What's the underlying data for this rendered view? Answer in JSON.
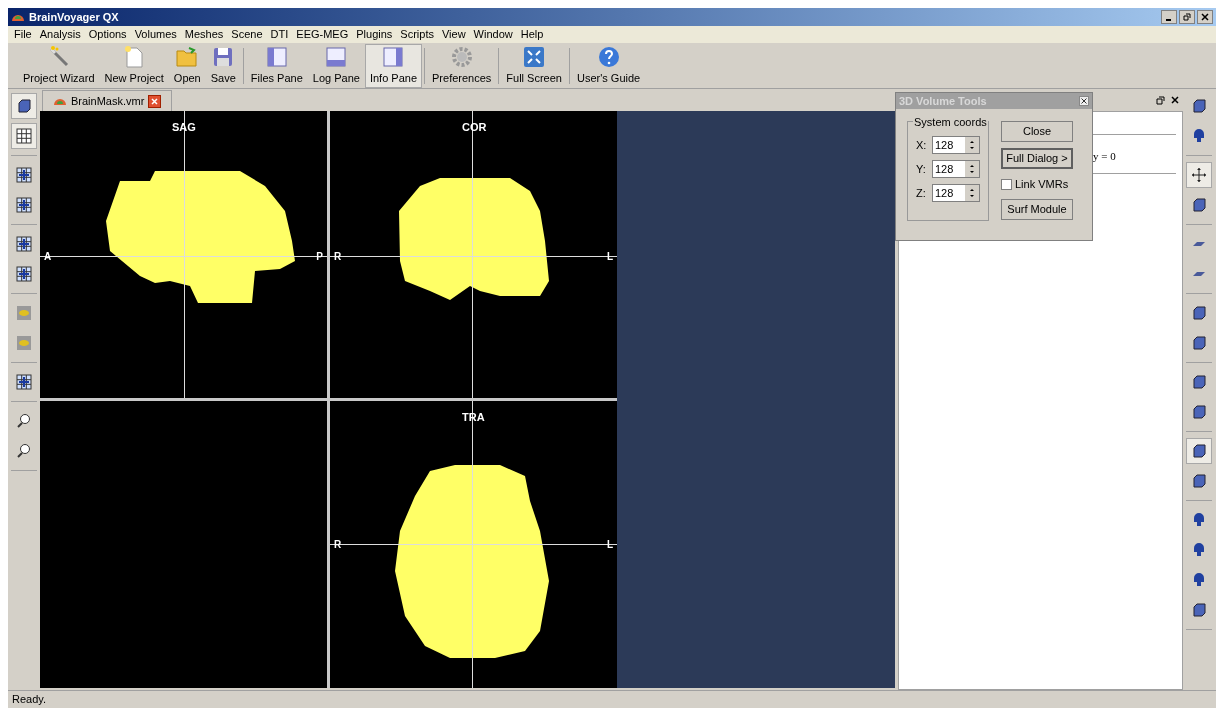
{
  "window": {
    "title": "BrainVoyager QX"
  },
  "menu": [
    "File",
    "Analysis",
    "Options",
    "Volumes",
    "Meshes",
    "Scene",
    "DTI",
    "EEG-MEG",
    "Plugins",
    "Scripts",
    "View",
    "Window",
    "Help"
  ],
  "toolbar": [
    {
      "label": "Project Wizard",
      "selected": false
    },
    {
      "label": "New Project",
      "selected": false
    },
    {
      "label": "Open",
      "selected": false
    },
    {
      "label": "Save",
      "selected": false
    },
    {
      "label": "Files Pane",
      "selected": false
    },
    {
      "label": "Log Pane",
      "selected": false
    },
    {
      "label": "Info Pane",
      "selected": true
    },
    {
      "label": "Preferences",
      "selected": false
    },
    {
      "label": "Full Screen",
      "selected": false
    },
    {
      "label": "User's Guide",
      "selected": false
    }
  ],
  "document_tab": {
    "label": "BrainMask.vmr"
  },
  "left_tools": [
    [
      {
        "selected": true
      },
      {
        "selected": true
      }
    ],
    [
      {
        "selected": false
      },
      {
        "selected": false
      }
    ],
    [
      {
        "selected": false
      },
      {
        "selected": false
      }
    ],
    [
      {
        "selected": false
      },
      {
        "selected": false
      }
    ],
    [
      {
        "selected": false
      }
    ],
    [
      {
        "selected": false
      },
      {
        "selected": false
      }
    ]
  ],
  "right_tools": [
    [
      {
        "selected": false
      },
      {
        "selected": false
      }
    ],
    [
      {
        "selected": true
      },
      {
        "selected": false
      }
    ],
    [
      {
        "selected": false
      },
      {
        "selected": false
      }
    ],
    [
      {
        "selected": false
      },
      {
        "selected": false
      }
    ],
    [
      {
        "selected": false
      },
      {
        "selected": false
      }
    ],
    [
      {
        "selected": true
      },
      {
        "selected": false
      }
    ],
    [
      {
        "selected": false
      },
      {
        "selected": false
      },
      {
        "selected": false
      },
      {
        "selected": false
      }
    ]
  ],
  "views": [
    {
      "kind": "sag",
      "title": "SAG",
      "left": "A",
      "right": "P"
    },
    {
      "kind": "cor",
      "title": "COR",
      "left": "R",
      "right": "L"
    },
    {
      "kind": "empty"
    },
    {
      "kind": "tra",
      "title": "TRA",
      "left": "R",
      "right": "L"
    }
  ],
  "info_pane": {
    "text": "y = 0"
  },
  "volume_tools": {
    "title": "3D Volume Tools",
    "group": "System coords",
    "coords": [
      {
        "label": "X:",
        "value": "128"
      },
      {
        "label": "Y:",
        "value": "128"
      },
      {
        "label": "Z:",
        "value": "128"
      }
    ],
    "buttons": [
      "Close",
      "Full Dialog >",
      "Surf Module"
    ],
    "link": {
      "label": "Link VMRs",
      "checked": false
    }
  },
  "status_bar": "Ready."
}
